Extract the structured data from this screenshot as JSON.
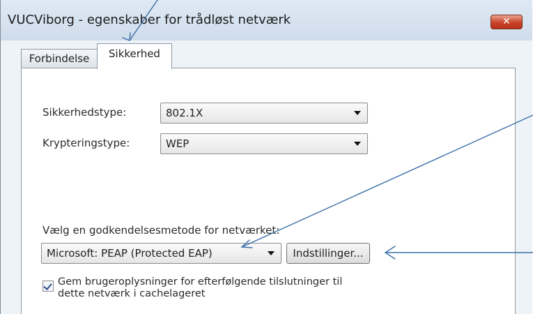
{
  "window": {
    "title": "VUCViborg - egenskaber for trådløst netværk",
    "close_glyph": "✕"
  },
  "tabs": [
    {
      "label": "Forbindelse",
      "selected": false
    },
    {
      "label": "Sikkerhed",
      "selected": true
    }
  ],
  "security": {
    "type_label": "Sikkerhedstype:",
    "type_value": "802.1X",
    "encryption_label": "Krypteringstype:",
    "encryption_value": "WEP"
  },
  "auth": {
    "method_label": "Vælg en godkendelsesmetode for netværket:",
    "method_value": "Microsoft: PEAP (Protected EAP)",
    "settings_button": "Indstillinger..."
  },
  "remember": {
    "checked": true,
    "label_line1": "Gem brugeroplysninger for efterfølgende tilslutninger til",
    "label_line2": "dette netværk i cachelageret"
  },
  "annotations": {
    "arrow_color": "#3b6fa8",
    "arrow_count": 3
  }
}
